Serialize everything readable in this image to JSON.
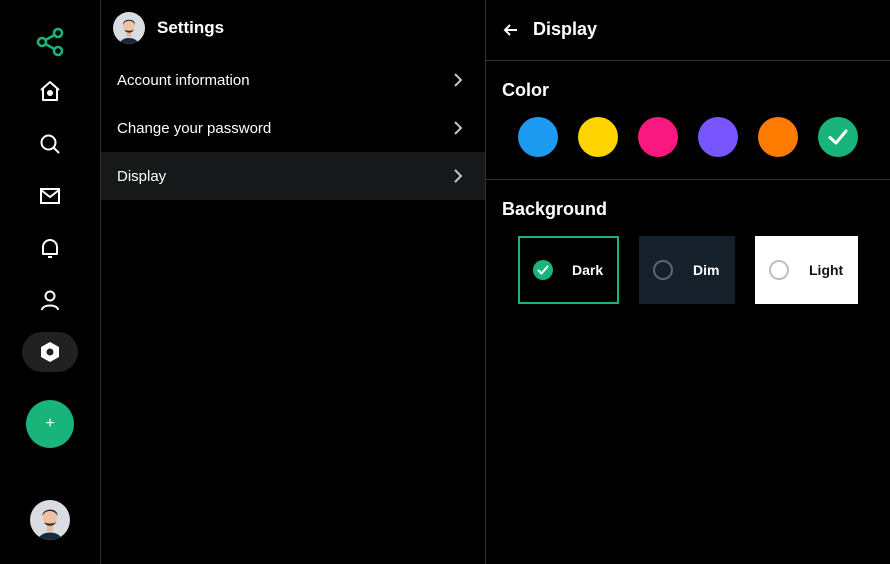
{
  "app": {
    "accent_color": "#19b47a",
    "compose_label": "+"
  },
  "nav": {
    "items": [
      {
        "name": "connect",
        "icon": "share-nodes-icon"
      },
      {
        "name": "home",
        "icon": "home-icon"
      },
      {
        "name": "explore",
        "icon": "search-icon"
      },
      {
        "name": "messages",
        "icon": "mail-icon"
      },
      {
        "name": "notifications",
        "icon": "bell-icon"
      },
      {
        "name": "profile",
        "icon": "user-icon"
      },
      {
        "name": "settings",
        "icon": "settings-hexagon-icon",
        "active": true
      }
    ]
  },
  "settings": {
    "title": "Settings",
    "menu": [
      {
        "label": "Account information"
      },
      {
        "label": "Change your password"
      },
      {
        "label": "Display",
        "active": true
      }
    ]
  },
  "display": {
    "title": "Display",
    "color_section_title": "Color",
    "colors": [
      {
        "hex": "#1d9bf0",
        "selected": false
      },
      {
        "hex": "#ffd400",
        "selected": false
      },
      {
        "hex": "#f91880",
        "selected": false
      },
      {
        "hex": "#7856ff",
        "selected": false
      },
      {
        "hex": "#ff7a00",
        "selected": false
      },
      {
        "hex": "#19b47a",
        "selected": true
      }
    ],
    "background_section_title": "Background",
    "backgrounds": [
      {
        "label": "Dark",
        "selected": true,
        "bg": "#000000",
        "text": "#ffffff"
      },
      {
        "label": "Dim",
        "selected": false,
        "bg": "#15202b",
        "text": "#ffffff"
      },
      {
        "label": "Light",
        "selected": false,
        "bg": "#ffffff",
        "text": "#0f1419"
      }
    ]
  }
}
